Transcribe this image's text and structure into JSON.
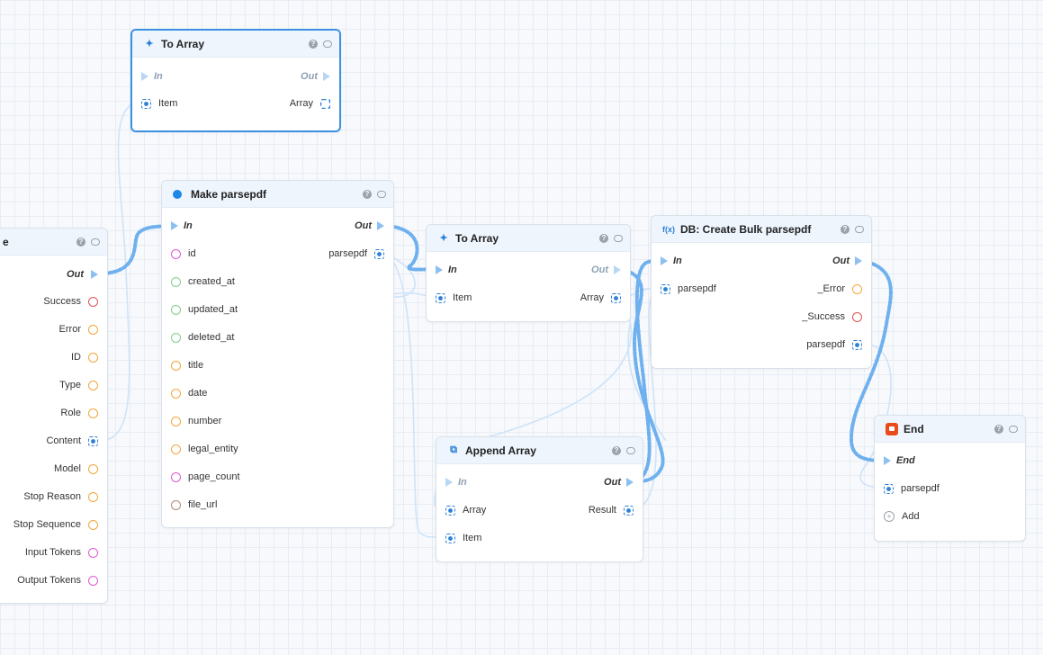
{
  "colors": {
    "accent": "#3b91e0",
    "pin_red": "#e05555",
    "pin_orange": "#f0a83a",
    "pin_magenta": "#e05ad6",
    "pin_green": "#7fd18a",
    "pin_brown": "#b08a7a",
    "pin_array": "#2b7fd6",
    "end_icon": "#ea4b1c"
  },
  "left_node": {
    "title_fragment": "e",
    "out_label": "Out",
    "pins": [
      {
        "label": "Success",
        "type": "circle",
        "color": "#e05555"
      },
      {
        "label": "Error",
        "type": "circle",
        "color": "#f0a83a"
      },
      {
        "label": "ID",
        "type": "circle",
        "color": "#f0a83a"
      },
      {
        "label": "Type",
        "type": "circle",
        "color": "#f0a83a"
      },
      {
        "label": "Role",
        "type": "circle",
        "color": "#f0a83a"
      },
      {
        "label": "Content",
        "type": "array"
      },
      {
        "label": "Model",
        "type": "circle",
        "color": "#f0a83a"
      },
      {
        "label": "Stop Reason",
        "type": "circle",
        "color": "#f0a83a"
      },
      {
        "label": "Stop Sequence",
        "type": "circle",
        "color": "#f0a83a"
      },
      {
        "label": "Input Tokens",
        "type": "circle",
        "color": "#e05ad6"
      },
      {
        "label": "Output Tokens",
        "type": "circle",
        "color": "#e05ad6"
      }
    ]
  },
  "to_array_top": {
    "title": "To Array",
    "icon": "sparkle-icon",
    "in_label": "In",
    "out_label": "Out",
    "item_label": "Item",
    "array_label": "Array"
  },
  "make_parsepdf": {
    "title": "Make parsepdf",
    "icon": "dot-icon",
    "in_label": "In",
    "out_label": "Out",
    "output_label": "parsepdf",
    "fields": [
      {
        "label": "id",
        "color": "#e05ad6"
      },
      {
        "label": "created_at",
        "color": "#7fd18a"
      },
      {
        "label": "updated_at",
        "color": "#7fd18a"
      },
      {
        "label": "deleted_at",
        "color": "#7fd18a"
      },
      {
        "label": "title",
        "color": "#f0a83a"
      },
      {
        "label": "date",
        "color": "#f0a83a"
      },
      {
        "label": "number",
        "color": "#f0a83a"
      },
      {
        "label": "legal_entity",
        "color": "#f0a83a"
      },
      {
        "label": "page_count",
        "color": "#e05ad6"
      },
      {
        "label": "file_url",
        "color": "#b08a7a"
      }
    ]
  },
  "to_array_mid": {
    "title": "To Array",
    "icon": "sparkle-icon",
    "in_label": "In",
    "out_label": "Out",
    "item_label": "Item",
    "array_label": "Array"
  },
  "db_create": {
    "title": "DB: Create Bulk parsepdf",
    "icon": "function-icon",
    "icon_text": "f(x)",
    "in_label": "In",
    "out_label": "Out",
    "input_label": "parsepdf",
    "error_label": "_Error",
    "success_label": "_Success",
    "output_label": "parsepdf"
  },
  "append_array": {
    "title": "Append Array",
    "icon": "copy-icon",
    "in_label": "In",
    "out_label": "Out",
    "array_label": "Array",
    "result_label": "Result",
    "item_label": "Item"
  },
  "end_node": {
    "title": "End",
    "icon": "stop-icon",
    "in_label": "End",
    "pin_label": "parsepdf",
    "add_label": "Add"
  }
}
